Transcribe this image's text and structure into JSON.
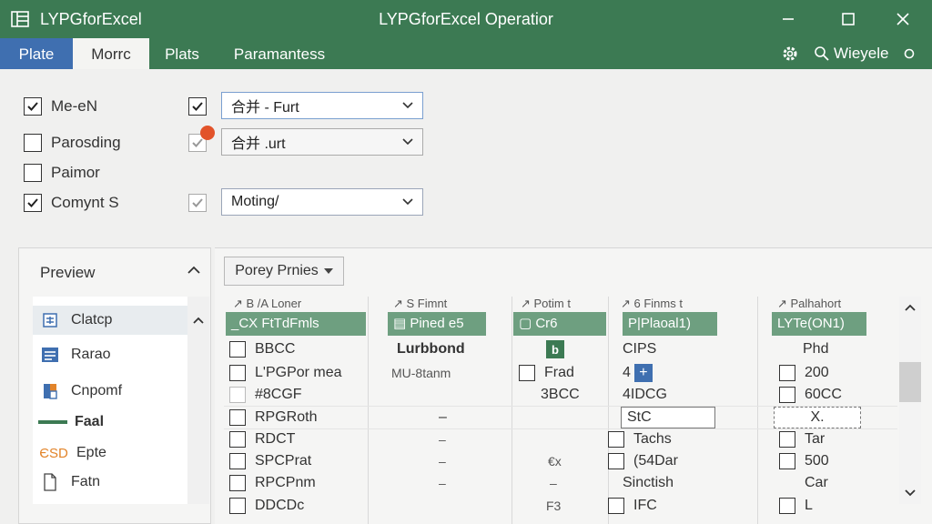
{
  "app": {
    "name": "LYPGforExcel",
    "window_title": "LYPGforExcel Operatior"
  },
  "tabs": [
    {
      "label": "Plate"
    },
    {
      "label": "Morrc"
    },
    {
      "label": "Plats"
    },
    {
      "label": "Paramantess"
    }
  ],
  "toolbar": {
    "user_name": "Wieyele"
  },
  "options": {
    "left": [
      {
        "label": "Me-eN",
        "checked": true
      },
      {
        "label": "Parosding",
        "checked": false
      },
      {
        "label": "Paimor",
        "checked": false
      },
      {
        "label": "Comynt  S",
        "checked": true
      }
    ],
    "dropdowns": [
      {
        "value": "合并 - Furt"
      },
      {
        "value": "合并 .urt"
      },
      {
        "value": "Moting/"
      }
    ]
  },
  "preview": {
    "label": "Preview",
    "items": [
      {
        "label": "Clatcp",
        "icon": "sheet-icon"
      },
      {
        "label": "Rarao",
        "icon": "list-icon"
      },
      {
        "label": "Cnpomf",
        "icon": "component-icon"
      },
      {
        "label": "Faal",
        "icon": "dash-icon"
      },
      {
        "label": "Epte",
        "prefix": "ЄSD",
        "icon": "text-icon"
      },
      {
        "label": "Fatn",
        "icon": "file-icon"
      }
    ]
  },
  "filter": {
    "label": "Porey Prnies"
  },
  "grid": {
    "columns": [
      {
        "top": "↗ B /A Loner",
        "head": "_CX FtTdFmls"
      },
      {
        "top": "↗ S Fimnt",
        "head": "▤ Pined e5"
      },
      {
        "top": "↗ Potim t",
        "head": "▢ Cr6"
      },
      {
        "top": "↗ 6 Finms t",
        "head": "P|Plaoal1)"
      },
      {
        "top": "↗ Palhahort",
        "head": "LYTe(ON1)"
      }
    ],
    "rows": [
      {
        "c1": "BBCC",
        "c2": "Lurbbond",
        "c3": "",
        "c4": "CIPS",
        "c5": "Phd"
      },
      {
        "c1": "L'PGPor mea",
        "c2": "MU-8tanm",
        "c3": "Frad",
        "c4": "4",
        "c5": "200"
      },
      {
        "c1": "#8CGF",
        "c2": "",
        "c3": "3BCC",
        "c4": "4IDCG",
        "c5": "60CC"
      },
      {
        "c1": "RPGRoth",
        "c2": "–",
        "c3": "",
        "c4": "StC",
        "c5": "X."
      },
      {
        "c1": "RDCT",
        "c2": "–",
        "c3": "",
        "c4": "Tachs",
        "c5": "Tar"
      },
      {
        "c1": "SPCPrat",
        "c2": "–",
        "c3": "€x",
        "c4": "(54Dar",
        "c5": "500"
      },
      {
        "c1": "RPCPnm",
        "c2": "–",
        "c3": "–",
        "c4": "Sinctish",
        "c5": "Car"
      },
      {
        "c1": "DDCDc",
        "c2": "",
        "c3": "F3",
        "c4": "IFC",
        "c5": "L"
      }
    ]
  },
  "colors": {
    "title_bar": "#3c7a53",
    "active_tab": "#3f6fb0",
    "grid_header": "#6e9f80",
    "badge": "#e2532a",
    "accent_blue": "#3f6fb0"
  }
}
